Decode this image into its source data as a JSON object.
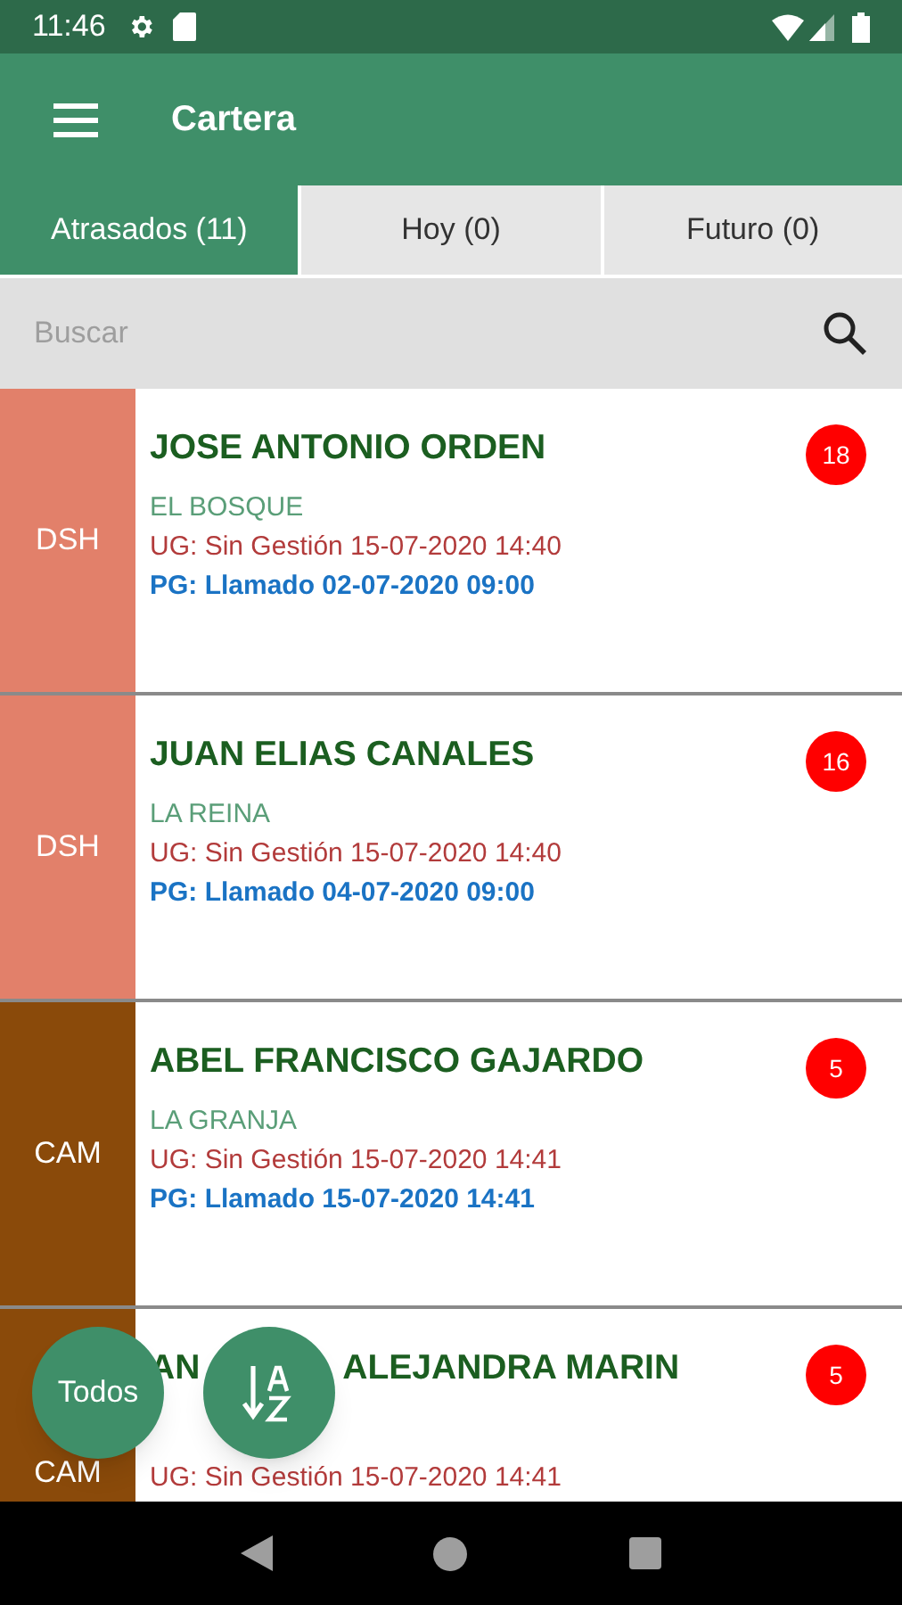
{
  "status_bar": {
    "time": "11:46"
  },
  "app_bar": {
    "title": "Cartera"
  },
  "tabs": [
    {
      "label": "Atrasados (11)",
      "selected": true
    },
    {
      "label": "Hoy (0)",
      "selected": false
    },
    {
      "label": "Futuro (0)",
      "selected": false
    }
  ],
  "search": {
    "placeholder": "Buscar"
  },
  "cards": [
    {
      "tag": "DSH",
      "color": "#e2806a",
      "name": "JOSE ANTONIO ORDEN",
      "commune": "EL BOSQUE",
      "last_action": "UG: Sin Gestión 15-07-2020 14:40",
      "planned_action": "PG: Llamado 02-07-2020 09:00",
      "count": "18"
    },
    {
      "tag": "DSH",
      "color": "#e2806a",
      "name": "JUAN ELIAS CANALES",
      "commune": "LA REINA",
      "last_action": "UG: Sin Gestión 15-07-2020 14:40",
      "planned_action": "PG: Llamado 04-07-2020 09:00",
      "count": "16"
    },
    {
      "tag": "CAM",
      "color": "#8a4a0a",
      "name": "ABEL FRANCISCO GAJARDO",
      "commune": "LA GRANJA",
      "last_action": "UG: Sin Gestión 15-07-2020 14:41",
      "planned_action": "PG: Llamado 15-07-2020 14:41",
      "count": "5"
    },
    {
      "tag": "CAM",
      "color": "#8a4a0a",
      "name_parts": [
        "AN",
        "ALEJANDRA MARIN"
      ],
      "last_action": "UG: Sin Gestión 15-07-2020 14:41",
      "count": "5"
    }
  ],
  "fabs": [
    {
      "kind": "text",
      "label": "Todos"
    },
    {
      "kind": "sort"
    }
  ]
}
